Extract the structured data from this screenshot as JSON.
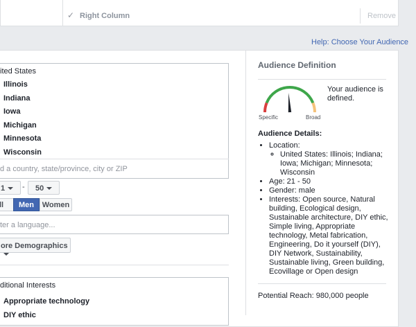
{
  "top": {
    "right_column_label": "Right Column",
    "remove_label": "Remove",
    "check_icon": "check-icon"
  },
  "help_link": "Help: Choose Your Audience",
  "location": {
    "country": "ited States",
    "states": [
      "Illinois",
      "Indiana",
      "Iowa",
      "Michigan",
      "Minnesota",
      "Wisconsin"
    ],
    "placeholder": "d a country, state/province, city or ZIP"
  },
  "age": {
    "min": "1",
    "dash": "-",
    "max": "50"
  },
  "gender": {
    "options": [
      "ll",
      "Men",
      "Women"
    ],
    "selected": "Men"
  },
  "language": {
    "placeholder": "ter a language..."
  },
  "more_demographics": "ore Demographics",
  "interests": {
    "title": "ditional Interests",
    "items": [
      "Appropriate technology",
      "DIY ethic"
    ]
  },
  "audience": {
    "title": "Audience Definition",
    "gauge_specific": "Specific",
    "gauge_broad": "Broad",
    "gauge_level": 0.48,
    "defined_text": "Your audience is defined.",
    "details_title": "Audience Details:",
    "location_label": "Location:",
    "location_value": "United States: Illinois; Indiana; Iowa; Michigan; Minnesota; Wisconsin",
    "age": "Age: 21 - 50",
    "gender": "Gender: male",
    "interests": "Interests: Open source, Natural building, Ecological design, Sustainable architecture, DIY ethic, Simple living, Appropriate technology, Metal fabrication, Engineering, Do it yourself (DIY), DIY Network, Sustainability, Sustainable living, Green building, Ecovillage or Open design",
    "reach": "Potential Reach: 980,000 people"
  },
  "colors": {
    "accent": "#4267b2",
    "gauge_red": "#d93f3f",
    "gauge_green": "#3ea64a",
    "gauge_orange": "#f5c27a"
  }
}
